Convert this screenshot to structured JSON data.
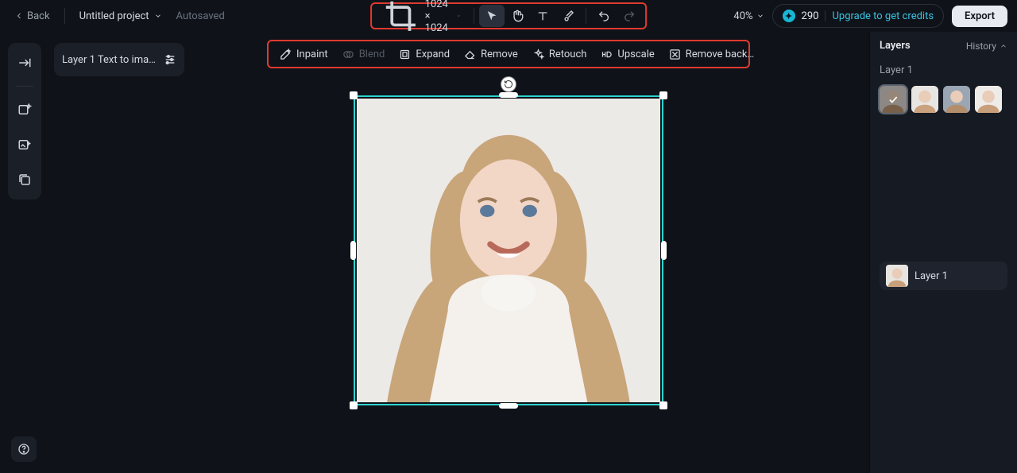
{
  "header": {
    "back": "Back",
    "project_name": "Untitled project",
    "autosaved": "Autosaved",
    "zoom": "40%",
    "credits": "290",
    "upgrade": "Upgrade to get credits",
    "export": "Export",
    "canvas_size": "1024 × 1024"
  },
  "layer_chip": {
    "label": "Layer 1 Text to ima…"
  },
  "actions": {
    "inpaint": "Inpaint",
    "blend": "Blend",
    "expand": "Expand",
    "remove": "Remove",
    "retouch": "Retouch",
    "upscale": "Upscale",
    "removebg": "Remove back…"
  },
  "panel": {
    "tab_layers": "Layers",
    "tab_history": "History",
    "layer_group": "Layer 1",
    "layer_row": "Layer 1"
  }
}
